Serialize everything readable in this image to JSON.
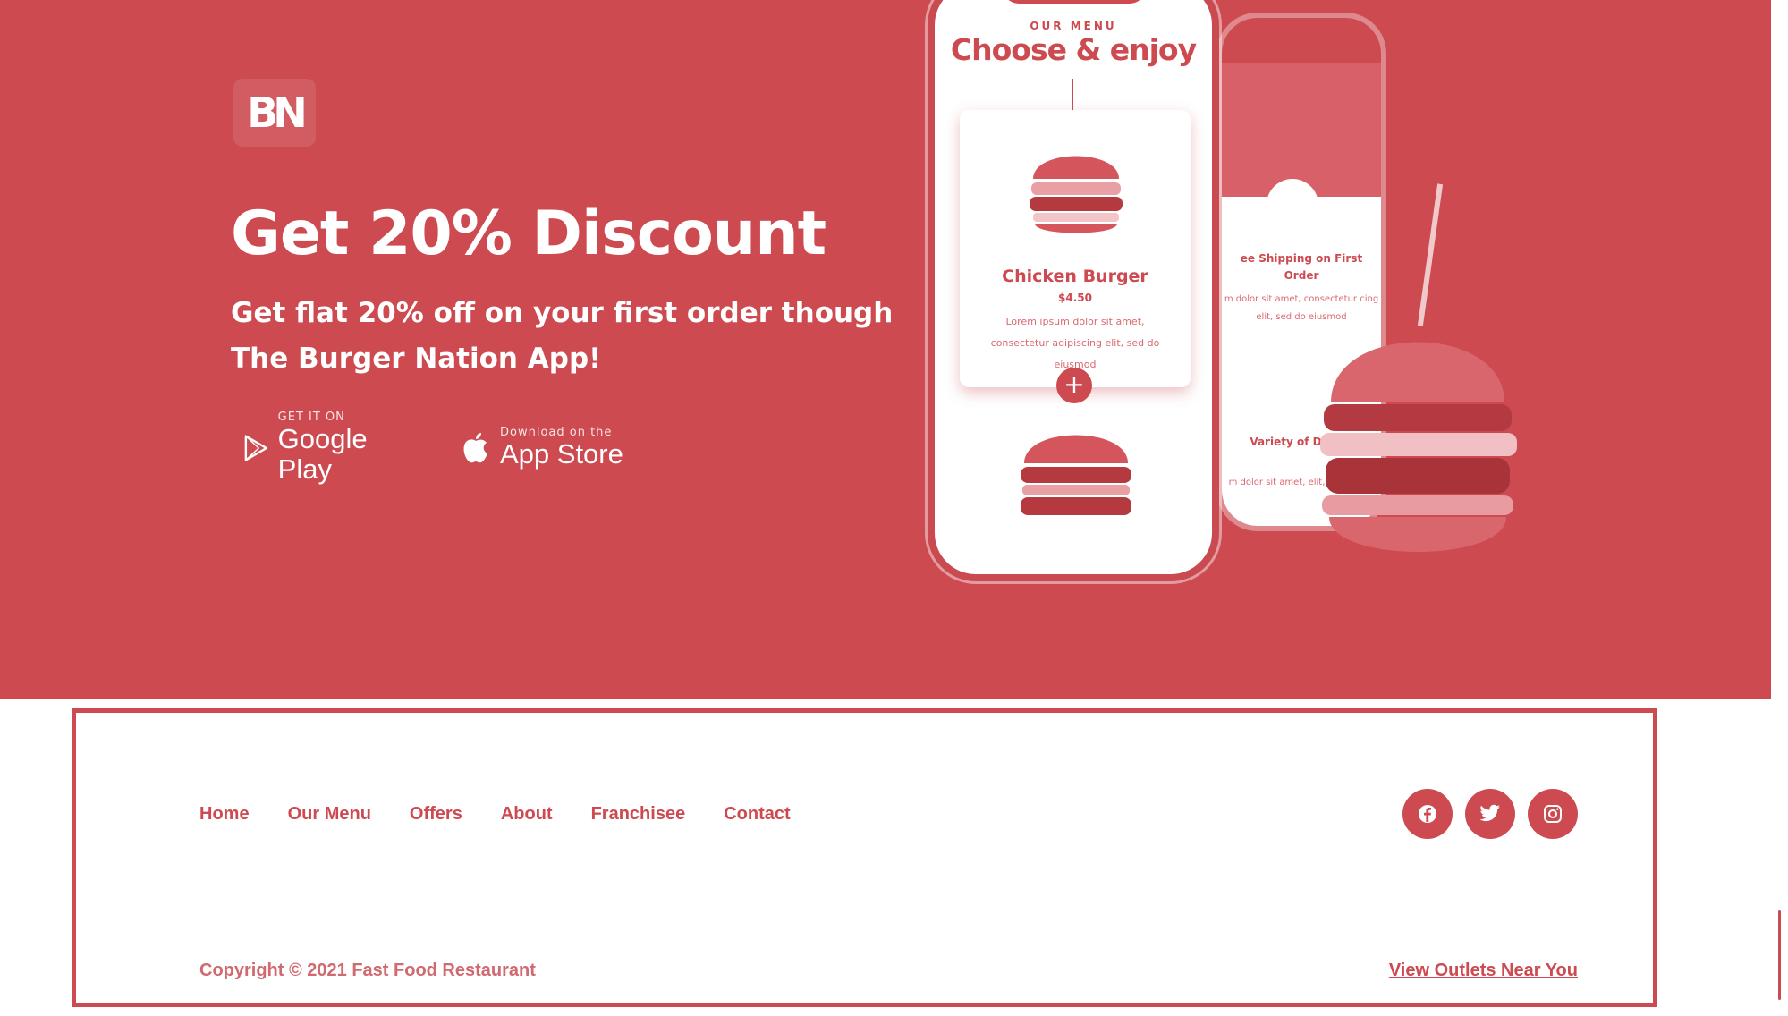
{
  "brand": {
    "logo_text": "BN"
  },
  "hero": {
    "title": "Get 20% Discount",
    "subtitle": "Get flat 20% off on your first order though The Burger Nation App!",
    "google": {
      "small": "GET IT ON",
      "big": "Google Play"
    },
    "apple": {
      "small": "Download on the",
      "big": "App Store"
    }
  },
  "phone_front": {
    "kicker": "OUR MENU",
    "title": "Choose & enjoy",
    "item_name": "Chicken Burger",
    "item_price": "$4.50",
    "item_desc": "Lorem ipsum dolor sit amet, consectetur adipiscing elit, sed do eiusmod",
    "add_symbol": "+"
  },
  "phone_back": {
    "feature1_title": "ee Shipping on First Order",
    "feature1_desc": "m dolor sit amet, consectetur cing elit, sed do eiusmod",
    "feature2_title": "Variety of Dishes",
    "feature2_desc": "m dolor sit amet, elit, sed do eiu"
  },
  "footer": {
    "nav": [
      "Home",
      "Our Menu",
      "Offers",
      "About",
      "Franchisee",
      "Contact"
    ],
    "social_icons": [
      "facebook-icon",
      "twitter-icon",
      "instagram-icon"
    ],
    "copyright": "Copyright © 2021 Fast Food Restaurant",
    "outlets_link": "View Outlets Near You"
  },
  "colors": {
    "accent": "#cc4a50",
    "background": "#ffffff"
  }
}
